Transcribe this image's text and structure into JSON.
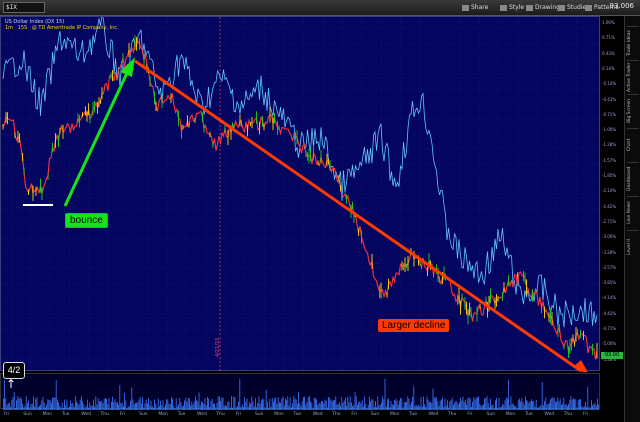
{
  "toolbar": {
    "symbol": "$IX",
    "buttons": [
      "Share",
      "Style",
      "Drawings",
      "Studies",
      "Patterns"
    ],
    "price": "93.006"
  },
  "chart": {
    "header": "US Dollar Index (DX 15)",
    "legend": [
      "1m",
      "15S",
      "@ TD Ameritrade IP Company, Inc."
    ]
  },
  "annotations": {
    "bounce": "bounce",
    "decline": "Larger decline",
    "date_badge": "4/2",
    "vline": "4/21/15"
  },
  "axis": {
    "ticks": [
      "1.00%",
      "0.71%",
      "0.43%",
      "0.14%",
      "-0.14%",
      "-0.43%",
      "-0.71%",
      "-1.00%",
      "-1.28%",
      "-1.57%",
      "-1.85%",
      "-2.14%",
      "-2.42%",
      "-2.71%",
      "-3.00%",
      "-3.28%",
      "-3.57%",
      "-3.85%",
      "-4.14%",
      "-4.42%",
      "-4.71%",
      "-5.00%",
      "-5.28%"
    ],
    "current_tag": "93.00"
  },
  "side_tabs": [
    "Trade Ideas",
    "Active Trader",
    "Big Screen",
    "Chart",
    "Dashboard",
    "Live News",
    "Level II"
  ],
  "time_labels": [
    "Fri",
    "Sun",
    "Mon",
    "Tue",
    "Wed",
    "Thu",
    "Fri",
    "Sun",
    "Mon",
    "Tue",
    "Wed",
    "Thu",
    "Fri",
    "Sun",
    "Mon",
    "Tue",
    "Wed",
    "Thu",
    "Fri",
    "Sun",
    "Mon",
    "Tue",
    "Wed",
    "Thu",
    "Fri",
    "Sun",
    "Mon",
    "Tue",
    "Wed",
    "Thu",
    "Fri"
  ],
  "colors": {
    "background": "#04055e",
    "price_line": "#ff3333",
    "up_bar": "#22d122",
    "indicator": "#62c6ff",
    "trend_arrow": "#ff3a00",
    "bounce_arrow": "#18e318"
  }
}
